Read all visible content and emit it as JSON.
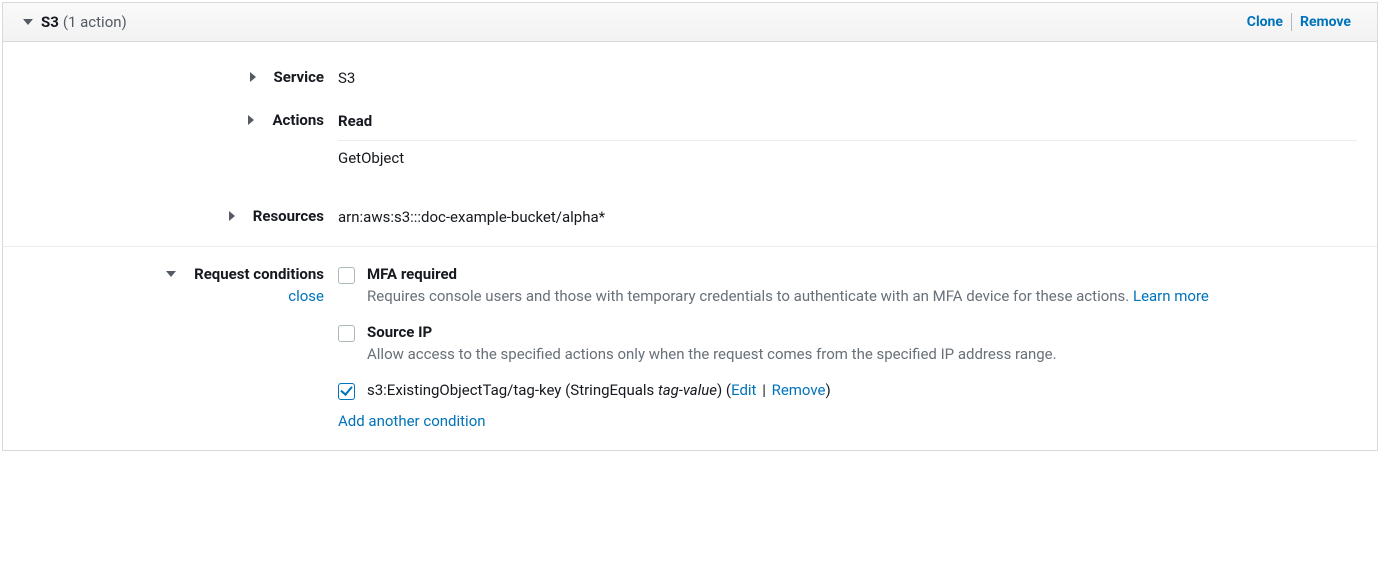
{
  "header": {
    "service_name": "S3",
    "action_count_text": "(1 action)",
    "clone_label": "Clone",
    "remove_label": "Remove"
  },
  "rows": {
    "service": {
      "label": "Service",
      "value": "S3"
    },
    "actions": {
      "label": "Actions",
      "group_heading": "Read",
      "items": [
        "GetObject"
      ]
    },
    "resources": {
      "label": "Resources",
      "value": "arn:aws:s3:::doc-example-bucket/alpha*"
    }
  },
  "conditions": {
    "label": "Request conditions",
    "close_label": "close",
    "mfa": {
      "title": "MFA required",
      "desc": "Requires console users and those with temporary credentials to authenticate with an MFA device for these actions.",
      "learn_more": "Learn more"
    },
    "source_ip": {
      "title": "Source IP",
      "desc": "Allow access to the specified actions only when the request comes from the specified IP address range."
    },
    "custom": {
      "key_text": "s3:ExistingObjectTag/tag-key",
      "open_paren": " (",
      "operator": "StringEquals ",
      "value_italic": "tag-value",
      "close_open": ") (",
      "edit_label": "Edit",
      "pipe": " | ",
      "remove_label": "Remove",
      "close_paren": ")"
    },
    "add_label": "Add another condition"
  }
}
